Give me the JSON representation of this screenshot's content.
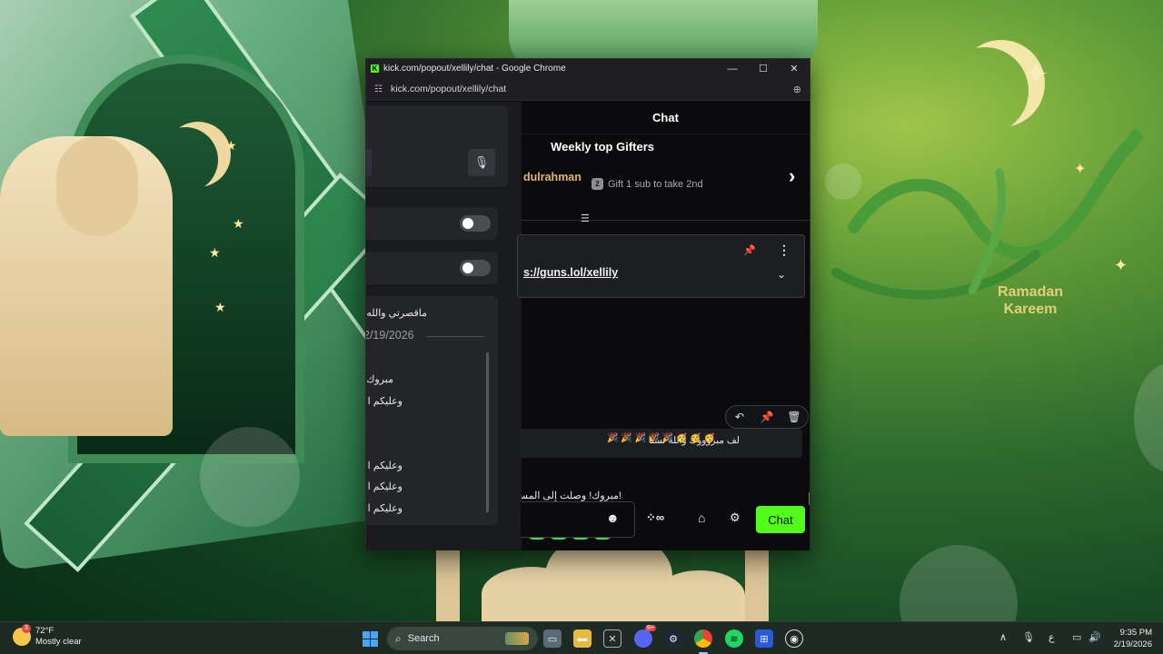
{
  "window": {
    "title": "kick.com/popout/xellily/chat - Google Chrome",
    "url": "kick.com/popout/xellily/chat",
    "logo_letter": "K"
  },
  "left_panel": {
    "items": [
      "ماقصرتي والله",
      "مبروك",
      "وعليكم ا",
      "وعليكم ا",
      "وعليكم ا",
      "وعليكم ا"
    ],
    "date": "2/19/2026"
  },
  "chat": {
    "header": "Chat",
    "gifters_title": "Weekly top Gifters",
    "top_gifter": "dulrahman",
    "gift_tip_badge": "2",
    "gift_tip": "Gift 1 sub to take 2nd",
    "pinned_link": "s://guns.lol/xellily",
    "message_text": "لف مبروووك والله تستا",
    "message_emotes": "🎉 🎉 🎉 🎉 🎉 🥳 🥳 🥳",
    "system_message": "!مبروك! وصلت إلى المسـ",
    "send_button": "Chat"
  },
  "desktop": {
    "greeting_line1": "Ramadan",
    "greeting_line2": "Kareem"
  },
  "taskbar": {
    "temperature": "72°F",
    "weather": "Mostly clear",
    "weather_badge": "3",
    "search_placeholder": "Search",
    "ime_indicator": "ع",
    "time": "9:35 PM",
    "date": "2/19/2026",
    "discord_badge": "9+"
  },
  "colors": {
    "kick_green": "#53fc18",
    "gifter_gold": "#e3b66b",
    "chat_bg": "#0b0b0d"
  }
}
